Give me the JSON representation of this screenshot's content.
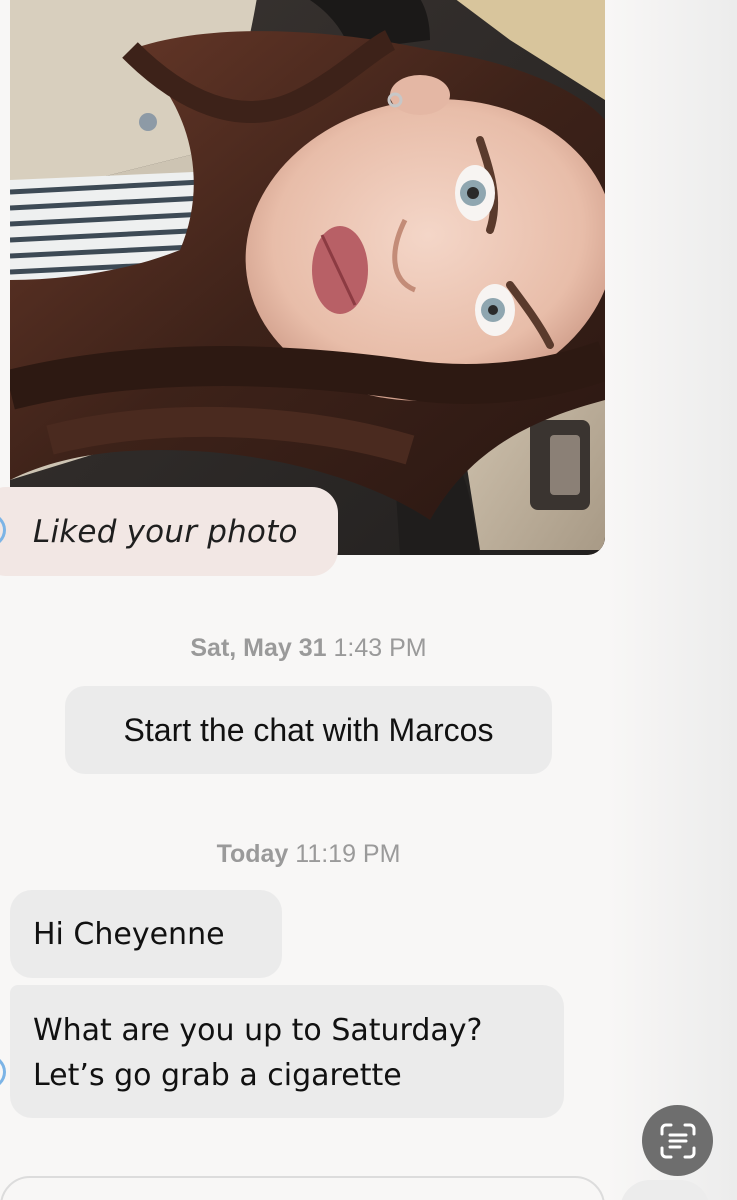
{
  "chat": {
    "liked_label": "Liked your photo",
    "timestamp_1": {
      "day": "Sat, May 31",
      "time": "1:43 PM"
    },
    "start_prompt": "Start the chat with Marcos",
    "timestamp_2": {
      "day": "Today",
      "time": "11:19 PM"
    },
    "messages": [
      {
        "lines": [
          "Hi Cheyenne"
        ]
      },
      {
        "lines": [
          "What are you up to Saturday?",
          "Let’s go grab a cigarette"
        ]
      }
    ]
  },
  "icons": {
    "scan": "text-scan-icon",
    "avatar": "avatar-ring-icon"
  },
  "colors": {
    "liked_bubble": "#f2e7e4",
    "message_bubble": "#ebebeb",
    "timestamp": "#9a9a9a",
    "avatar_ring": "#7cb4e6",
    "scan_button": "#6e6e6e"
  }
}
